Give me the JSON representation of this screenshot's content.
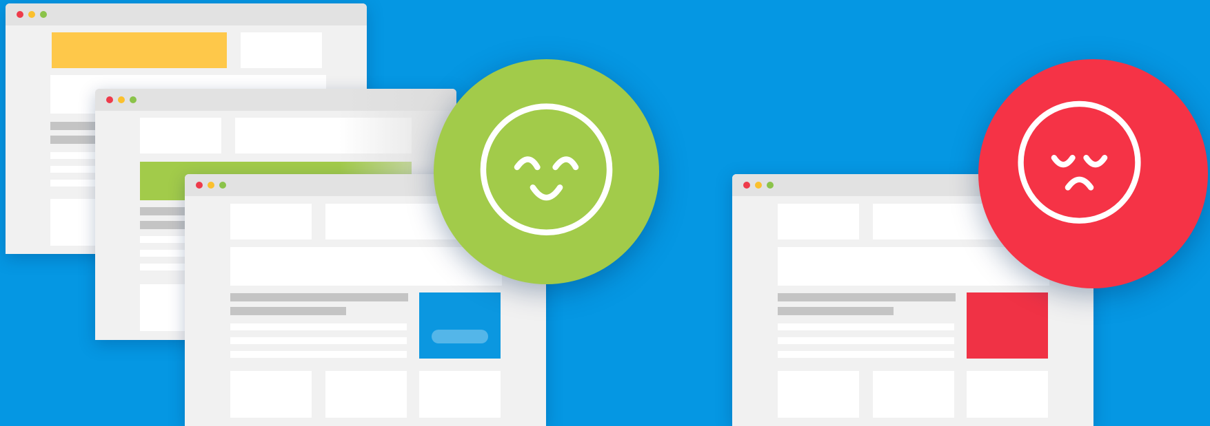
{
  "colors": {
    "background": "#0597e3",
    "window": "#f1f1f1",
    "titlebar": "#e2e2e2",
    "happy": "#a2cb4a",
    "sad": "#f53346",
    "yellow_block": "#fec84a",
    "green_block": "#a2cb4a",
    "blue_block": "#0b97e0",
    "red_block": "#f03245"
  },
  "icons": {
    "happy": "happy-face-icon",
    "sad": "sad-face-icon"
  }
}
